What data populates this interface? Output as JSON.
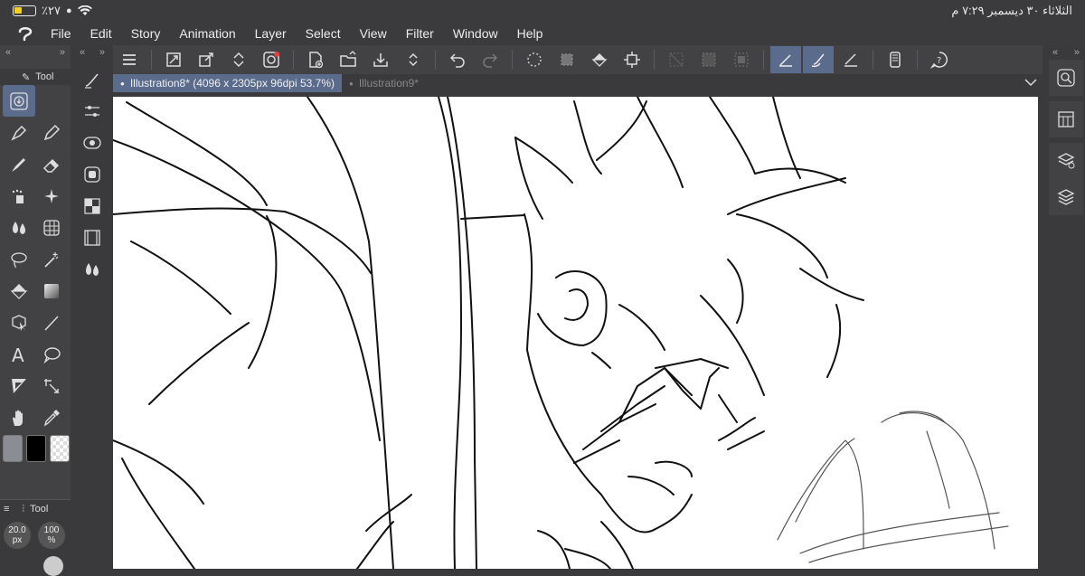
{
  "status_bar": {
    "battery_percent": "٪٢٧",
    "datetime": "الثلاثاء ٣٠ ديسمبر ٧:٢٩ م"
  },
  "menu": {
    "items": [
      "File",
      "Edit",
      "Story",
      "Animation",
      "Layer",
      "Select",
      "View",
      "Filter",
      "Window",
      "Help"
    ]
  },
  "tool_panel": {
    "title": "Tool"
  },
  "sub_tool_panel": {
    "title": "Tool",
    "brush_size": "20.0",
    "brush_size_unit": "px",
    "opacity": "100",
    "opacity_unit": "%"
  },
  "tabs": [
    {
      "label": "Illustration8* (4096 x 2305px 96dpi 53.7%)",
      "active": true
    },
    {
      "label": "Illustration9*",
      "active": false
    }
  ],
  "colors": {
    "main": "#8a8d94",
    "sub": "#000000",
    "accent": "#5a6b8c"
  }
}
